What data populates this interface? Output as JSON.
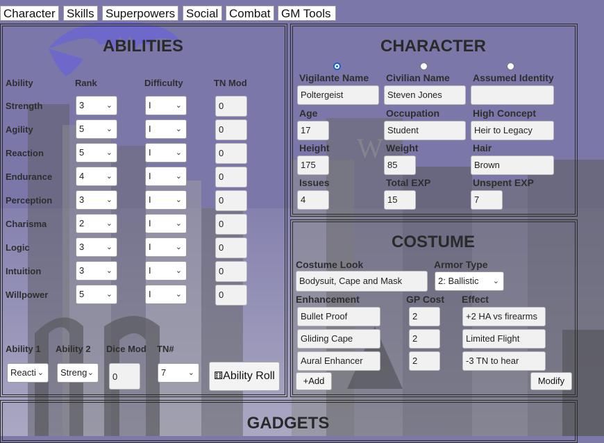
{
  "tabs": [
    "Character",
    "Skills",
    "Superpowers",
    "Social",
    "Combat",
    "GM Tools"
  ],
  "abilities": {
    "title": "ABILITIES",
    "headers": [
      "Ability",
      "Rank",
      "Difficulty",
      "TN Mod"
    ],
    "rows": [
      {
        "name": "Strength",
        "rank": "3",
        "difficulty": "I",
        "tn_mod": "0"
      },
      {
        "name": "Agility",
        "rank": "5",
        "difficulty": "I",
        "tn_mod": "0"
      },
      {
        "name": "Reaction",
        "rank": "5",
        "difficulty": "I",
        "tn_mod": "0"
      },
      {
        "name": "Endurance",
        "rank": "4",
        "difficulty": "I",
        "tn_mod": "0"
      },
      {
        "name": "Perception",
        "rank": "3",
        "difficulty": "I",
        "tn_mod": "0"
      },
      {
        "name": "Charisma",
        "rank": "2",
        "difficulty": "I",
        "tn_mod": "0"
      },
      {
        "name": "Logic",
        "rank": "3",
        "difficulty": "I",
        "tn_mod": "0"
      },
      {
        "name": "Intuition",
        "rank": "3",
        "difficulty": "I",
        "tn_mod": "0"
      },
      {
        "name": "Willpower",
        "rank": "5",
        "difficulty": "I",
        "tn_mod": "0"
      }
    ],
    "roll": {
      "ability1_label": "Ability 1",
      "ability2_label": "Ability 2",
      "dice_mod_label": "Dice Mod",
      "tn_label": "TN#",
      "ability1_value": "Reacti",
      "ability2_value": "Streng",
      "dice_mod_value": "0",
      "tn_value": "7",
      "button_label": "Ability Roll"
    }
  },
  "character": {
    "title": "CHARACTER",
    "fields": [
      {
        "label": "Vigilante Name",
        "value": "Poltergeist",
        "radio": true,
        "radio_selected": true
      },
      {
        "label": "Civilian Name",
        "value": "Steven Jones",
        "radio": true,
        "radio_selected": false
      },
      {
        "label": "Assumed Identity",
        "value": "",
        "radio": true,
        "radio_selected": false
      },
      {
        "label": "Age",
        "value": "17"
      },
      {
        "label": "Occupation",
        "value": "Student"
      },
      {
        "label": "High Concept",
        "value": "Heir to Legacy"
      },
      {
        "label": "Height",
        "value": "175"
      },
      {
        "label": "Weight",
        "value": "85"
      },
      {
        "label": "Hair",
        "value": "Brown"
      },
      {
        "label": "Issues",
        "value": "4"
      },
      {
        "label": "Total EXP",
        "value": "15"
      },
      {
        "label": "Unspent EXP",
        "value": "7"
      }
    ]
  },
  "costume": {
    "title": "COSTUME",
    "look_label": "Costume Look",
    "look_value": "Bodysuit, Cape and Mask",
    "armor_label": "Armor Type",
    "armor_value": "2: Ballistic",
    "enh_label": "Enhancement",
    "gp_label": "GP Cost",
    "effect_label": "Effect",
    "enhancements": [
      {
        "name": "Bullet Proof",
        "gp": "2",
        "effect": "+2 HA vs firearms"
      },
      {
        "name": "Gliding Cape",
        "gp": "2",
        "effect": "Limited Flight"
      },
      {
        "name": "Aural Enhancer",
        "gp": "2",
        "effect": "-3 TN to hear"
      }
    ],
    "add_label": "+Add",
    "modify_label": "Modify"
  },
  "gadgets": {
    "title": "GADGETS"
  },
  "colors": {
    "sky": "#7c78a8",
    "building": "#6f6f6f",
    "logo": "#6d68c8"
  }
}
